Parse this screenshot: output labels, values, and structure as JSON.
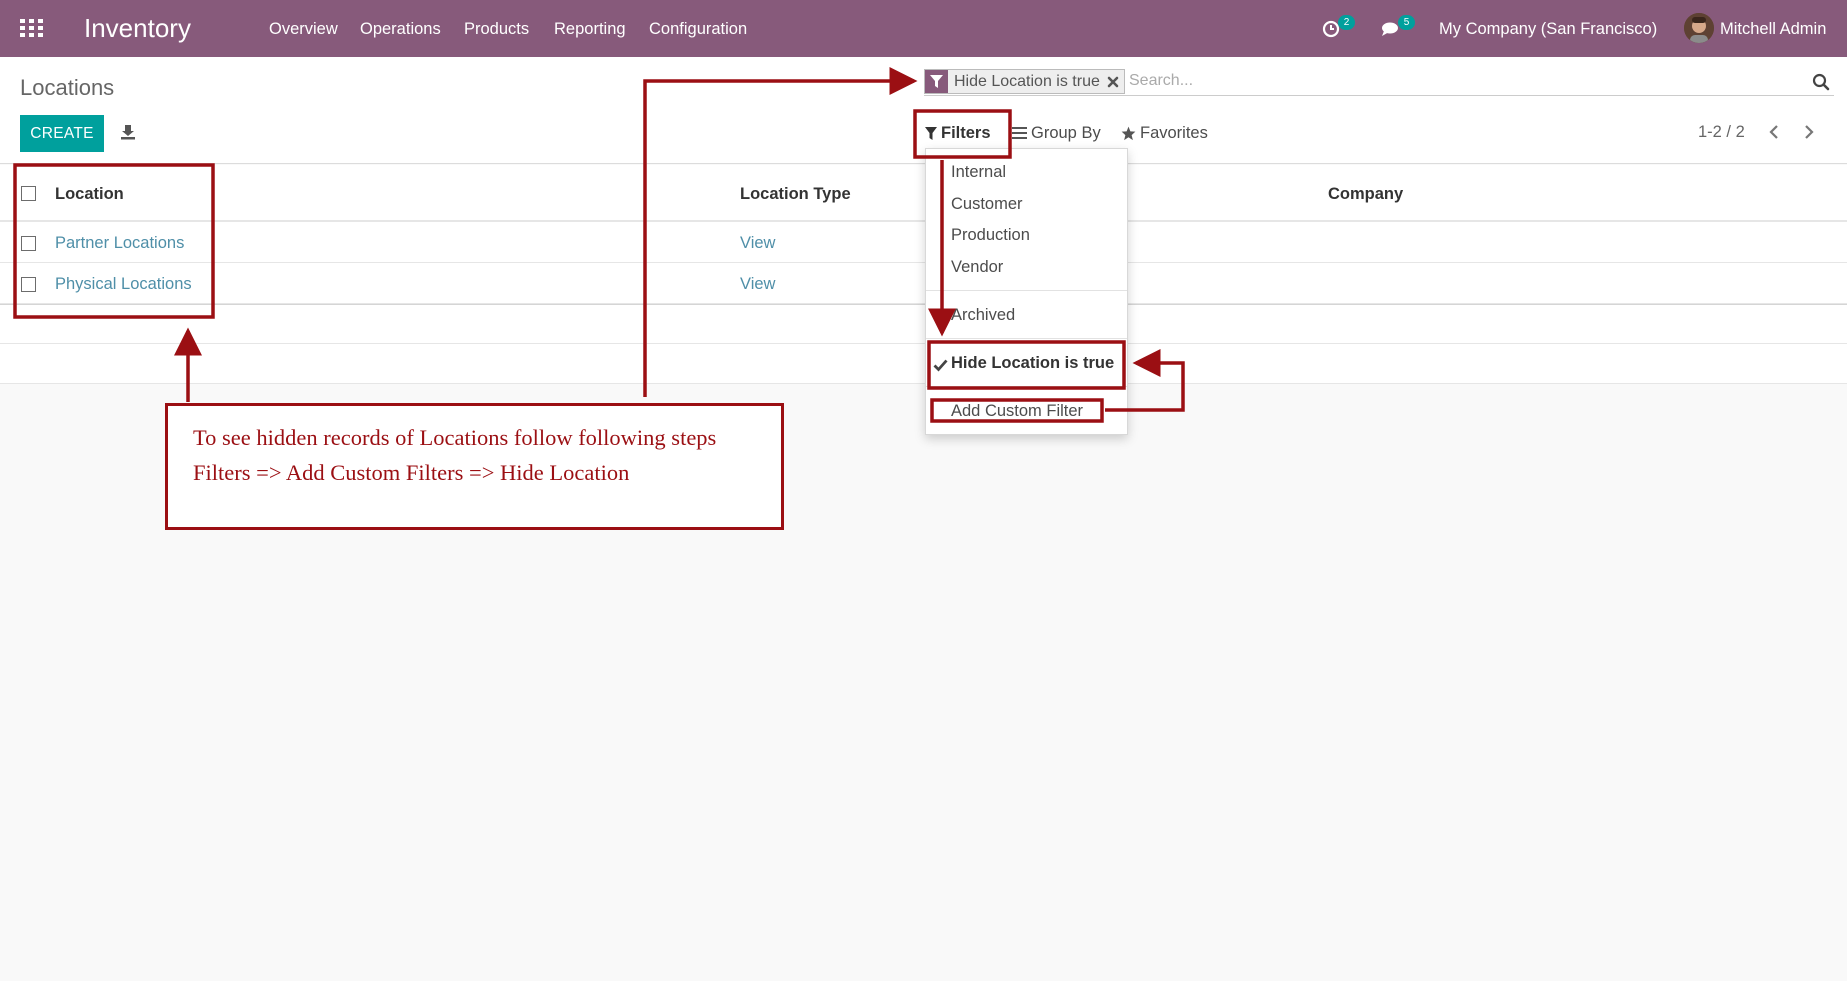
{
  "navbar": {
    "app_title": "Inventory",
    "menu": [
      "Overview",
      "Operations",
      "Products",
      "Reporting",
      "Configuration"
    ],
    "activity_count": "2",
    "message_count": "5",
    "company": "My Company (San Francisco)",
    "user": "Mitchell Admin",
    "color": "#875a7b"
  },
  "control_panel": {
    "breadcrumb": "Locations",
    "create_label": "CREATE",
    "search_facet": "Hide Location is true",
    "search_placeholder": "Search...",
    "filters_label": "Filters",
    "groupby_label": "Group By",
    "favorites_label": "Favorites",
    "pager": "1-2 / 2",
    "accent_color": "#00a09d"
  },
  "list": {
    "columns": [
      "Location",
      "Location Type",
      "Company"
    ],
    "rows": [
      {
        "location": "Partner Locations",
        "type": "View",
        "company": ""
      },
      {
        "location": "Physical Locations",
        "type": "View",
        "company": ""
      }
    ]
  },
  "filter_menu": {
    "items": [
      "Internal",
      "Customer",
      "Production",
      "Vendor"
    ],
    "archived": "Archived",
    "custom_active": "Hide Location is true",
    "add_custom": "Add Custom Filter"
  },
  "annotation": {
    "line1": "To see hidden records of Locations follow following steps",
    "line2": "Filters => Add Custom Filters => Hide Location",
    "color": "#9b0f13"
  }
}
